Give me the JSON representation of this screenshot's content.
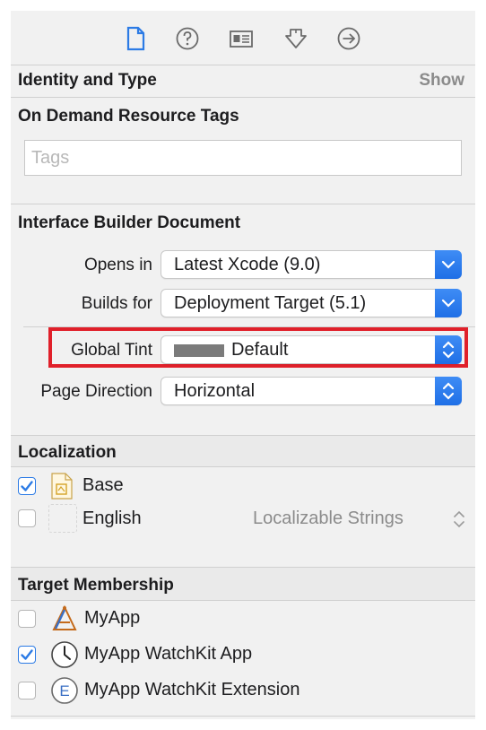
{
  "toolbar": {
    "tabs": [
      {
        "icon": "file-inspector-icon",
        "active": true
      },
      {
        "icon": "quick-help-icon"
      },
      {
        "icon": "identity-inspector-icon"
      },
      {
        "icon": "attributes-inspector-icon"
      },
      {
        "icon": "connections-inspector-icon"
      }
    ]
  },
  "identity": {
    "title": "Identity and Type",
    "show_label": "Show"
  },
  "odr": {
    "title": "On Demand Resource Tags",
    "placeholder": "Tags"
  },
  "ib": {
    "title": "Interface Builder Document",
    "opens_in_label": "Opens in",
    "opens_in_value": "Latest Xcode (9.0)",
    "builds_for_label": "Builds for",
    "builds_for_value": "Deployment Target (5.1)",
    "global_tint_label": "Global Tint",
    "global_tint_value": "Default",
    "page_direction_label": "Page Direction",
    "page_direction_value": "Horizontal"
  },
  "localization": {
    "title": "Localization",
    "items": [
      {
        "label": "Base",
        "checked": true
      },
      {
        "label": "English",
        "checked": false,
        "detail": "Localizable Strings"
      }
    ]
  },
  "membership": {
    "title": "Target Membership",
    "items": [
      {
        "label": "MyApp",
        "checked": false
      },
      {
        "label": "MyApp WatchKit App",
        "checked": true
      },
      {
        "label": "MyApp WatchKit Extension",
        "checked": false
      }
    ]
  },
  "colors": {
    "accent": "#2c7be5",
    "highlight": "#e0202a",
    "tint_swatch": "#7b7b7b"
  }
}
